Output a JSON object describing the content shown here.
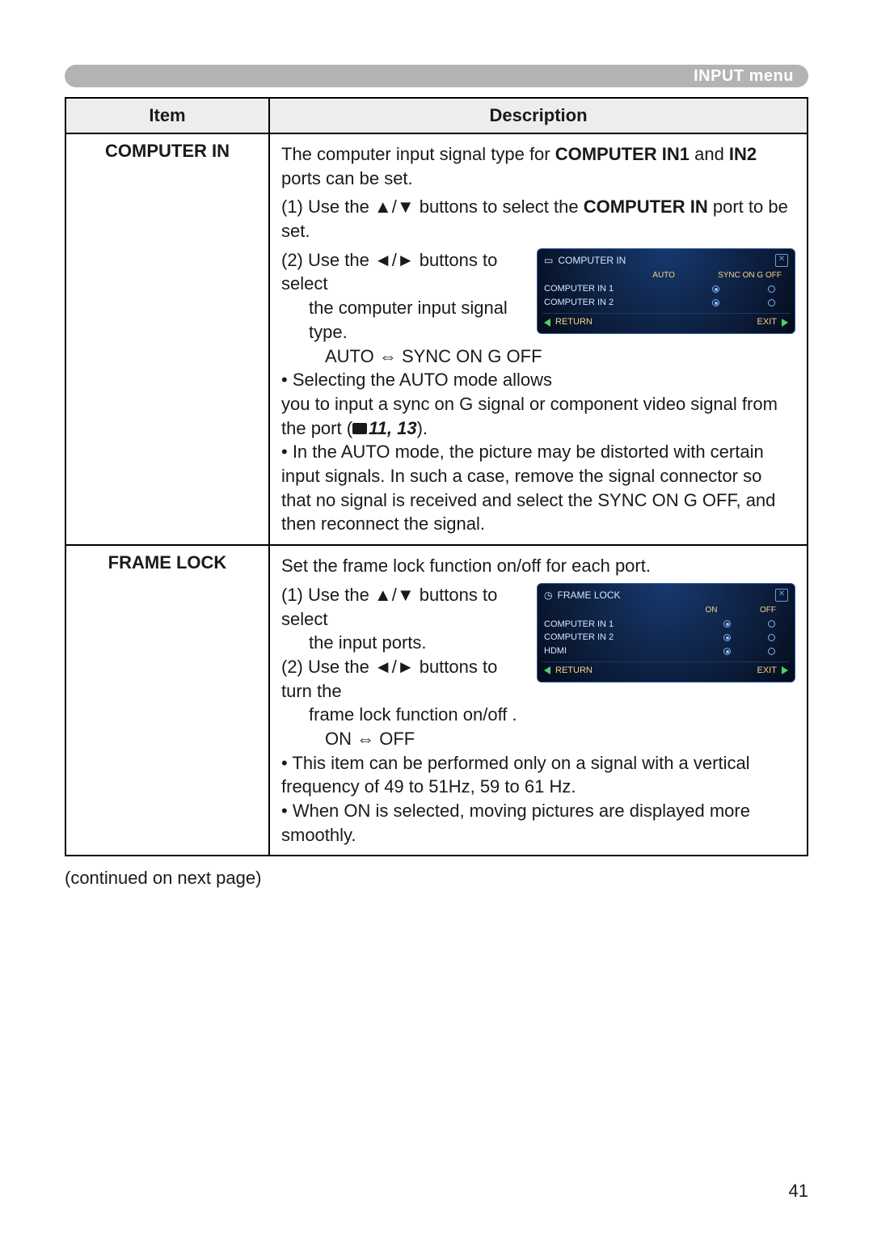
{
  "header": {
    "title": "INPUT menu"
  },
  "table": {
    "head": {
      "item": "Item",
      "desc": "Description"
    },
    "rows": [
      {
        "item": "COMPUTER IN",
        "intro_pre": "The computer input signal type for ",
        "intro_b1": "COMPUTER IN1",
        "intro_mid": " and ",
        "intro_b2": "IN2",
        "intro_post": " ports can be set.",
        "step1_pre": "(1) Use the ▲/▼ buttons to select the ",
        "step1_b": "COMPUTER IN",
        "step1_post": " port to be set.",
        "step2a": "(2) Use the ◄/► buttons to select",
        "step2b": "the computer input signal type.",
        "step2c": "AUTO ⇔ SYNC ON G OFF",
        "bullet1a": "• Selecting the AUTO mode allows",
        "bullet1b": "you to input a sync on G signal or component video signal from the port (",
        "bullet1_ref": "11, 13",
        "bullet1c": ").",
        "bullet2": "• In the AUTO mode, the picture may be distorted with certain input signals. In such a case, remove the signal connector so that no signal is received and select the SYNC ON G OFF, and then reconnect the signal.",
        "osd": {
          "title": "COMPUTER IN",
          "cols": [
            "AUTO",
            "SYNC ON G OFF"
          ],
          "rows": [
            {
              "label": "COMPUTER IN 1",
              "sel": 0
            },
            {
              "label": "COMPUTER IN 2",
              "sel": 0
            }
          ],
          "return": "RETURN",
          "exit": "EXIT"
        }
      },
      {
        "item": "FRAME LOCK",
        "intro": "Set the frame lock function on/off for each port.",
        "step1a": "(1) Use the ▲/▼ buttons to select",
        "step1b": "the input ports.",
        "step2a": "(2) Use the ◄/► buttons to turn the",
        "step2b": "frame lock function on/off .",
        "step2c": "ON ⇔ OFF",
        "bullet1": "• This item can be performed only on a signal with a vertical frequency of 49 to 51Hz, 59 to 61 Hz.",
        "bullet2": "• When ON is selected, moving pictures are displayed more smoothly.",
        "osd": {
          "title": "FRAME LOCK",
          "cols": [
            "ON",
            "OFF"
          ],
          "rows": [
            {
              "label": "COMPUTER IN 1",
              "sel": 0
            },
            {
              "label": "COMPUTER IN 2",
              "sel": 0
            },
            {
              "label": "HDMI",
              "sel": 0
            }
          ],
          "return": "RETURN",
          "exit": "EXIT"
        }
      }
    ]
  },
  "continue": "(continued on next page)",
  "page_number": "41"
}
